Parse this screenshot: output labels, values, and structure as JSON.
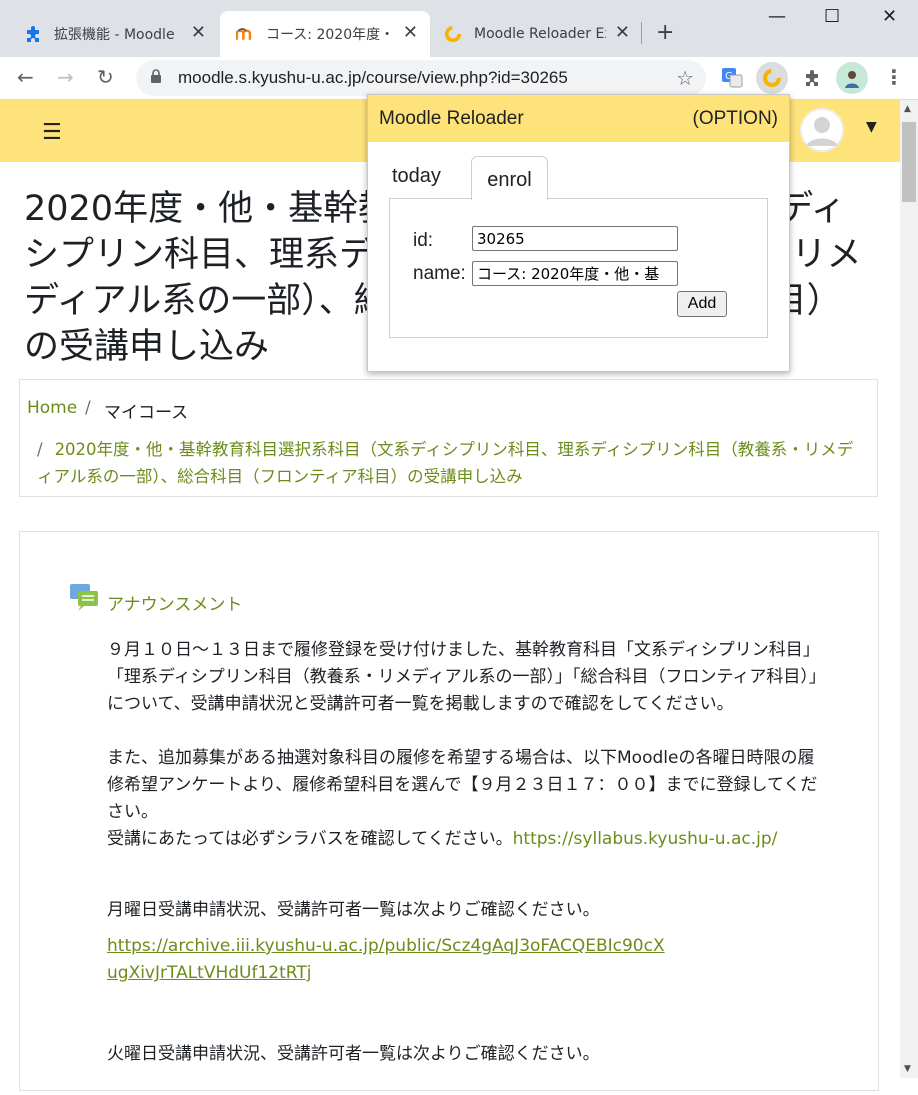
{
  "browser": {
    "tabs": [
      {
        "title": "拡張機能 - Moodle",
        "close": "✕"
      },
      {
        "title": "コース: 2020年度・他・",
        "close": "✕"
      },
      {
        "title": "Moodle Reloader Ex",
        "close": "✕"
      }
    ],
    "new_tab": "+",
    "window_controls": {
      "minimize": "—",
      "maximize": "☐",
      "close": "✕"
    },
    "url": "moodle.s.kyushu-u.ac.jp/course/view.php?id=30265",
    "nav": {
      "back": "←",
      "forward": "→",
      "reload": "↻"
    }
  },
  "moodle": {
    "page_title": "2020年度・他・基幹教育科目選択系科目（文系ディシプリン科目、理系ディシプリン科目（教養系・リメディアル系の一部）、総合科目（フロンティア科目）の受講申し込み",
    "breadcrumb": {
      "home": "Home",
      "separator": "/",
      "my_courses": "マイコース",
      "course": "2020年度・他・基幹教育科目選択系科目（文系ディシプリン科目、理系ディシプリン科目（教養系・リメディアル系の一部）、総合科目（フロンティア科目）の受講申し込み"
    },
    "forum_link": "アナウンスメント",
    "paragraphs": {
      "p1": "９月１０日～１３日まで履修登録を受け付けました、基幹教育科目「文系ディシプリン科目」「理系ディシプリン科目（教養系・リメディアル系の一部）」「総合科目（フロンティア科目）」について、受講申請状況と受講許可者一覧を掲載しますので確認をしてください。",
      "p2": "また、追加募集がある抽選対象科目の履修を希望する場合は、以下Moodleの各曜日時限の履修希望アンケートより、履修希望科目を選んで【９月２３日１７：００】までに登録してください。",
      "p3_text": "受講にあたっては必ずシラバスを確認してください。",
      "p3_link": "https://syllabus.kyushu-u.ac.jp/",
      "p4": "月曜日受講申請状況、受講許可者一覧は次よりご確認ください。",
      "p4_link": "https://archive.iii.kyushu-u.ac.jp/public/Scz4gAqJ3oFACQEBIc90cXugXivJrTALtVHdUf12tRTj",
      "p5": "火曜日受講申請状況、受講許可者一覧は次よりご確認ください。"
    }
  },
  "popup": {
    "title": "Moodle Reloader",
    "option": "(OPTION)",
    "tabs": {
      "today": "today",
      "enrol": "enrol"
    },
    "id_label": "id:",
    "id_value": "30265",
    "name_label": "name:",
    "name_value": "コース: 2020年度・他・基",
    "add_button": "Add"
  },
  "colors": {
    "navbar": "#fee27a",
    "link": "#6d8c1b"
  }
}
